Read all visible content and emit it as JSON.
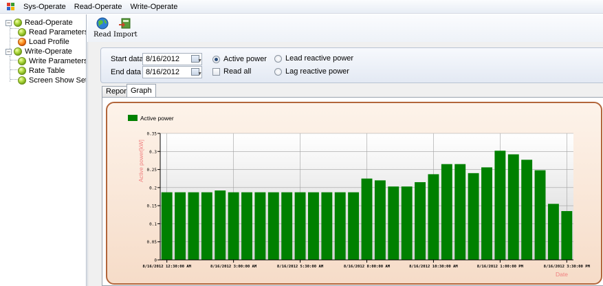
{
  "menu": {
    "items": [
      "Sys-Operate",
      "Read-Operate",
      "Write-Operate"
    ]
  },
  "tree": {
    "read_operate": "Read-Operate",
    "read_parameters": "Read Parameters",
    "load_profile": "Load Profile",
    "write_operate": "Write-Operate",
    "write_parameters": "Write Parameters",
    "rate_table": "Rate Table",
    "screen_show_set": "Screen Show Set"
  },
  "toolbar": {
    "read_label": "Read",
    "import_label": "Import"
  },
  "filter": {
    "start_label": "Start data",
    "start_value": "8/16/2012",
    "end_label": "End data",
    "end_value": "8/16/2012",
    "active_power": "Active power",
    "read_all": "Read all",
    "lead_reactive": "Lead reactive power",
    "lag_reactive": "Lag reactive power",
    "selected": "Active power"
  },
  "tabs": [
    "Report",
    "Graph"
  ],
  "active_tab": "Graph",
  "colors": {
    "bar": "#008000",
    "axis_title": "#f08080",
    "panel_border": "#b2653a"
  },
  "chart_data": {
    "type": "bar",
    "legend": "Active power",
    "legend_position": "top-left",
    "ylabel": "Active power[kW]",
    "xlabel": "Date",
    "ylim": [
      0,
      0.35
    ],
    "yticks": [
      "0",
      "0.05",
      "0.1",
      "0.15",
      "0.2",
      "0.25",
      "0.3",
      "0.35"
    ],
    "xticks": [
      "8/16/2012 12:30:00 AM",
      "8/16/2012 3:00:00 AM",
      "8/16/2012 5:30:00 AM",
      "8/16/2012 8:00:00 AM",
      "8/16/2012 10:30:00 AM",
      "8/16/2012 1:00:00 PM",
      "8/16/2012 3:30:00 PM"
    ],
    "grid": true,
    "values": [
      0.187,
      0.187,
      0.187,
      0.187,
      0.192,
      0.187,
      0.187,
      0.187,
      0.187,
      0.187,
      0.187,
      0.187,
      0.187,
      0.187,
      0.187,
      0.225,
      0.22,
      0.203,
      0.203,
      0.215,
      0.237,
      0.265,
      0.265,
      0.24,
      0.256,
      0.302,
      0.292,
      0.277,
      0.248,
      0.155,
      0.135
    ]
  }
}
